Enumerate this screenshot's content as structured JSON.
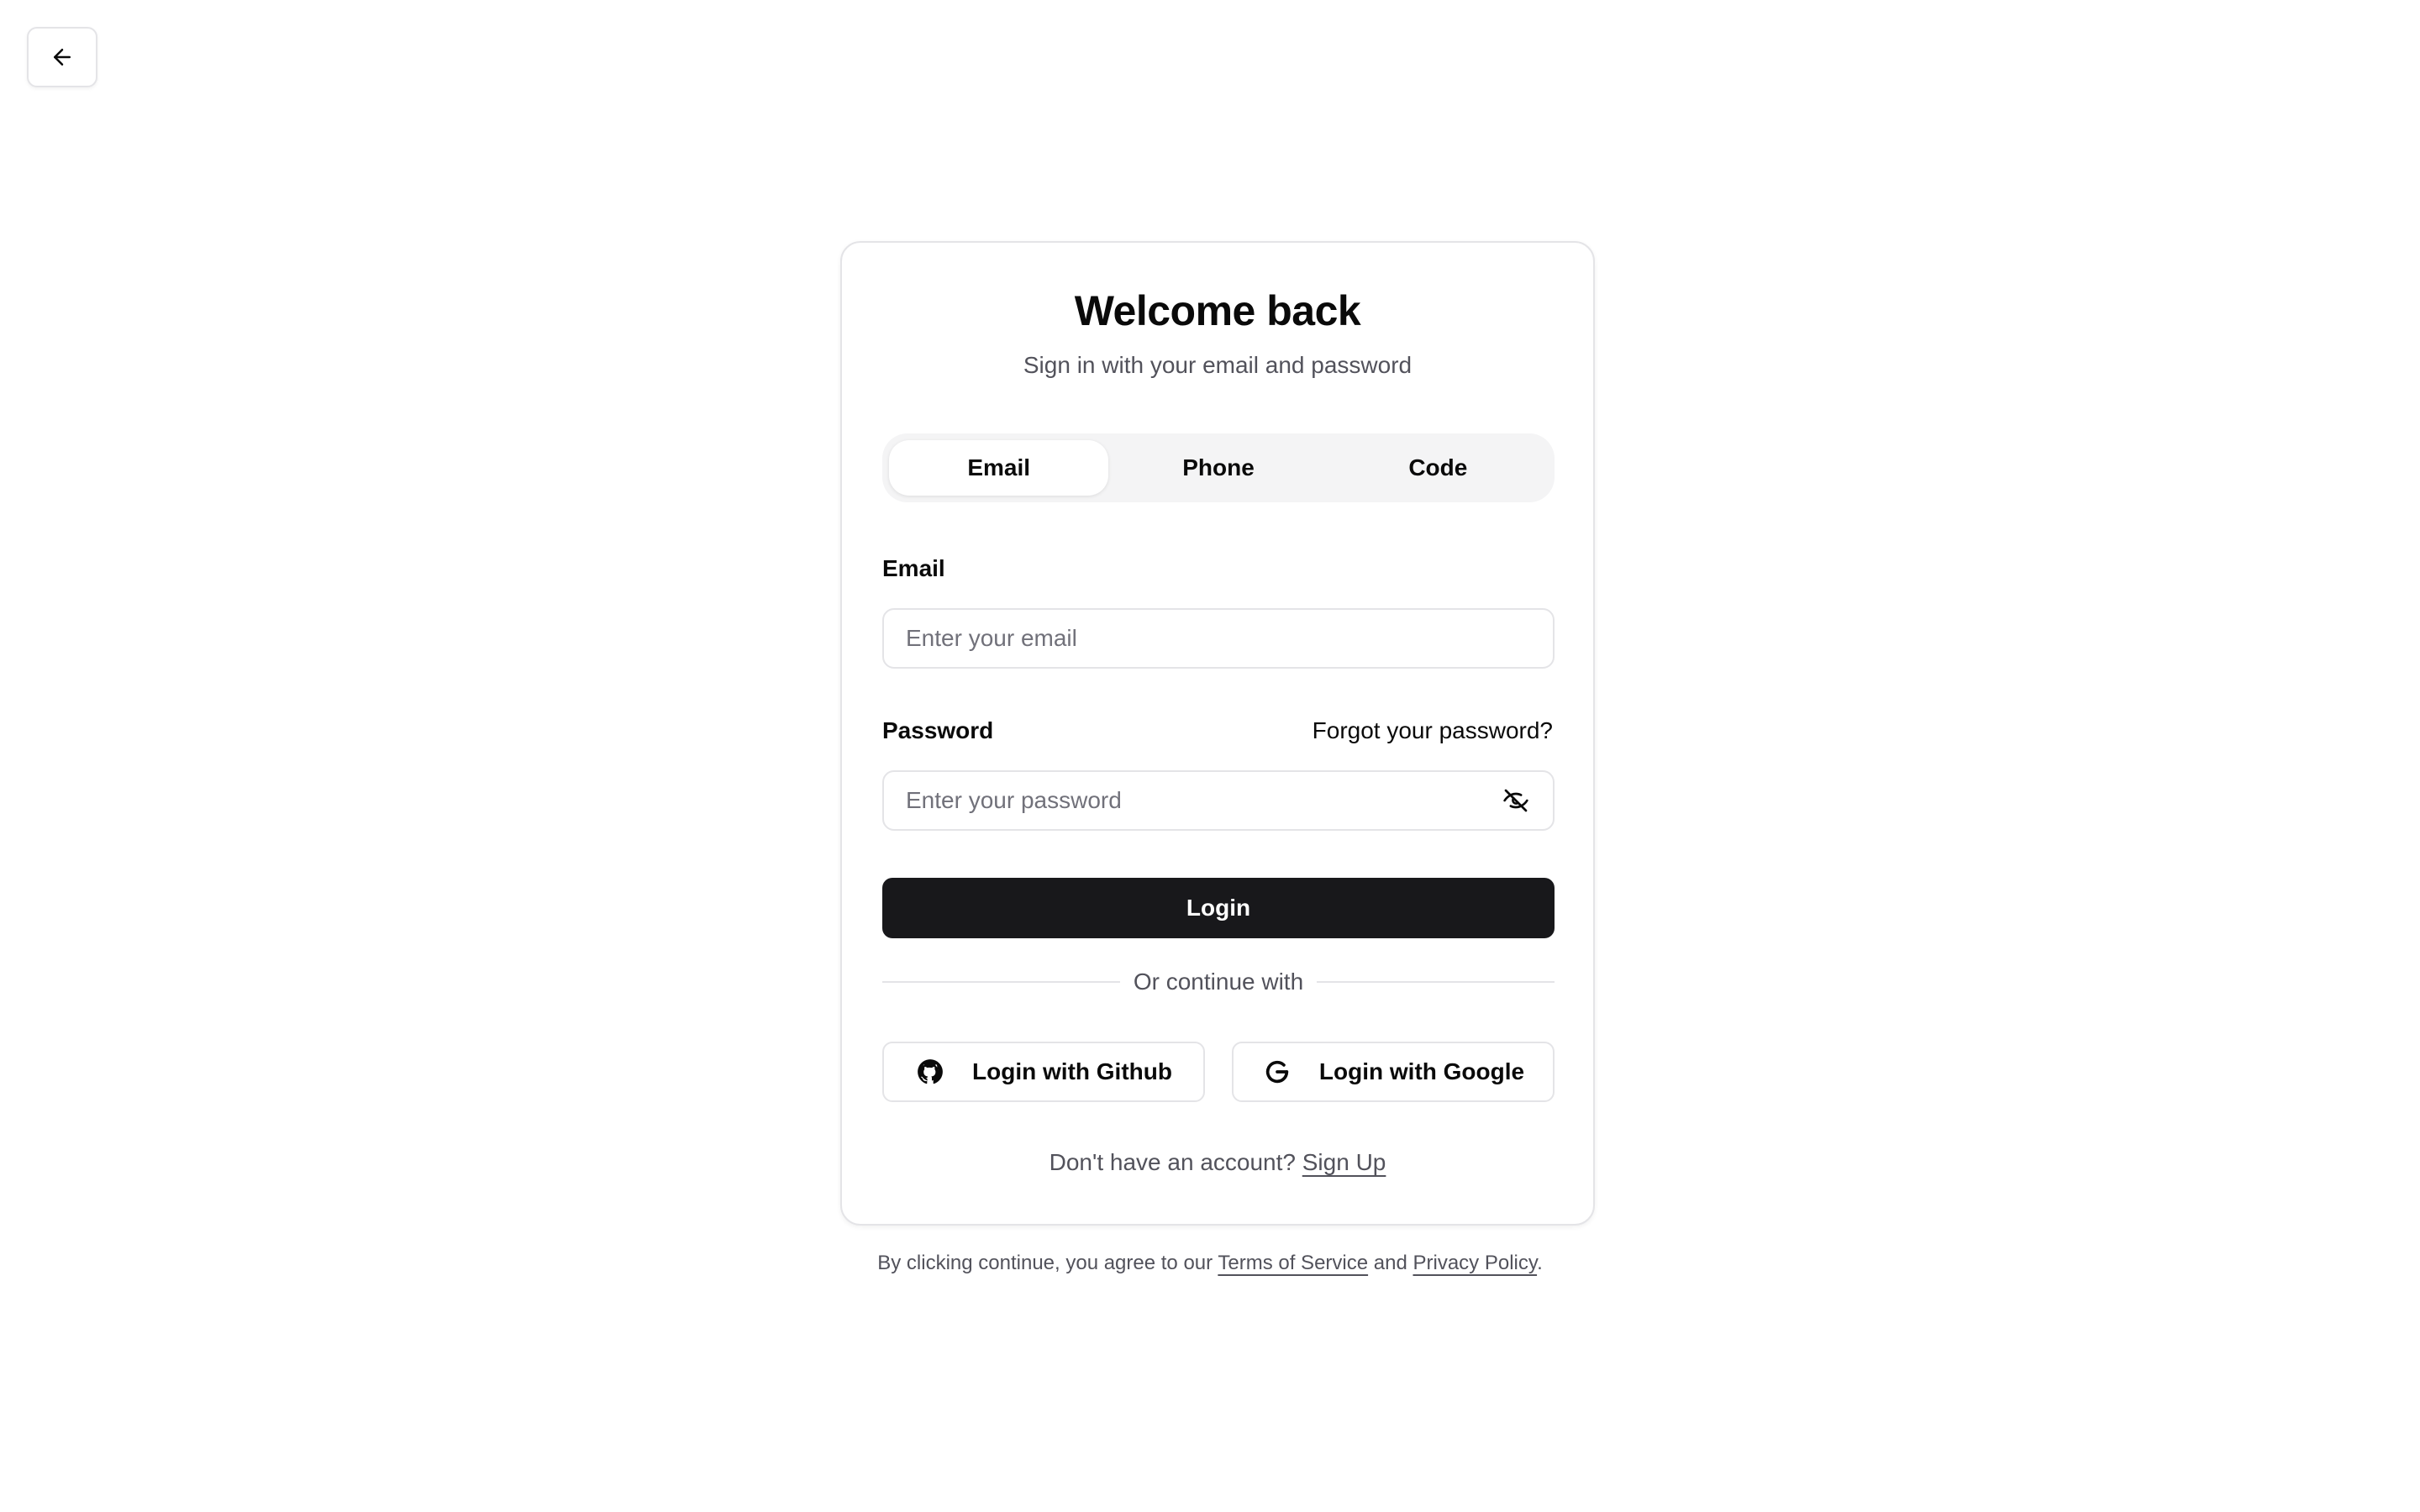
{
  "nav": {
    "back_icon": "arrow-left-icon"
  },
  "card": {
    "title": "Welcome back",
    "subtitle": "Sign in with your email and password"
  },
  "tabs": [
    {
      "label": "Email",
      "active": true
    },
    {
      "label": "Phone",
      "active": false
    },
    {
      "label": "Code",
      "active": false
    }
  ],
  "form": {
    "email_label": "Email",
    "email_placeholder": "Enter your email",
    "email_value": "",
    "password_label": "Password",
    "forgot_label": "Forgot your password?",
    "password_placeholder": "Enter your password",
    "password_value": "",
    "password_toggle_icon": "eye-off-icon",
    "login_label": "Login"
  },
  "divider": {
    "text": "Or continue with"
  },
  "oauth": {
    "github_label": "Login with Github",
    "github_icon": "github-icon",
    "google_label": "Login with Google",
    "google_icon": "google-icon"
  },
  "signup": {
    "prompt": "Don't have an account?",
    "link": "Sign Up"
  },
  "legal": {
    "prefix": "By clicking continue, you agree to our",
    "terms": "Terms of Service",
    "and": "and",
    "privacy": "Privacy Policy",
    "suffix": "."
  },
  "colors": {
    "primary": "#18181b",
    "border": "#e4e4e7",
    "muted_text": "#52525b",
    "tab_bg": "#f4f4f5"
  }
}
